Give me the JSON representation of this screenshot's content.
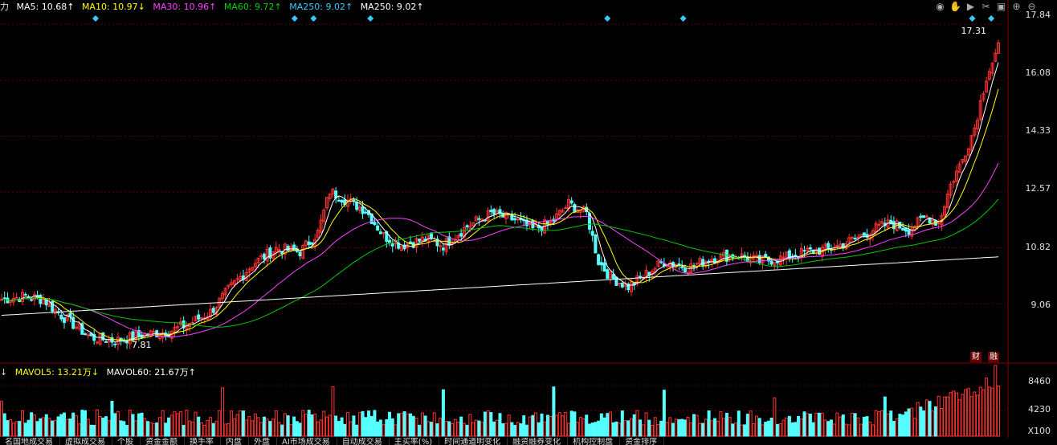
{
  "colors": {
    "up": "#ff3232",
    "down": "#54ffff",
    "grid": "#5a0000",
    "ma5": "#ffffff",
    "ma10": "#ffff00",
    "ma30": "#ff40ff",
    "ma60": "#00c800",
    "ma250": "#ffffff"
  },
  "ma_legend": {
    "prefix": "力",
    "ma5": "MA5: 10.68↑",
    "ma10": "MA10: 10.97↓",
    "ma30": "MA30: 10.96↑",
    "ma60": "MA60: 9.72↑",
    "ma250a": "MA250: 9.02↑",
    "ma250b": "MA250: 9.02↑"
  },
  "vol_legend": {
    "prefix": "↓",
    "mavol5": "MAVOL5: 13.21万↓",
    "mavol60": "MAVOL60: 21.67万↑"
  },
  "price_axis": [
    "17.84",
    "16.08",
    "14.33",
    "12.57",
    "10.82",
    "9.06"
  ],
  "vol_axis": [
    "8460",
    "4230",
    "X100"
  ],
  "annotations": {
    "high": "17.31",
    "low": "7.81",
    "tag_cai": "财",
    "tag_rongzi": "融"
  },
  "toolbar_icons": [
    "eye-icon",
    "hand-icon",
    "play-icon",
    "scissors-icon",
    "lock-icon",
    "zoom-in-icon",
    "zoom-out-icon"
  ],
  "tabs": [
    "名国地成交易",
    "虚拟成交易",
    "个股",
    "资金金额",
    "换手率",
    "内盘",
    "外盘",
    "AI市场成交易",
    "自动成交易",
    "主买率(%)",
    "时间通道明变化",
    "融资融券变化",
    "机构控制盘",
    "资金排序"
  ],
  "chart_data": {
    "type": "candlestick",
    "price_range": [
      7.2,
      18.1
    ],
    "volume_range": [
      0,
      9800
    ],
    "grid": true
  }
}
